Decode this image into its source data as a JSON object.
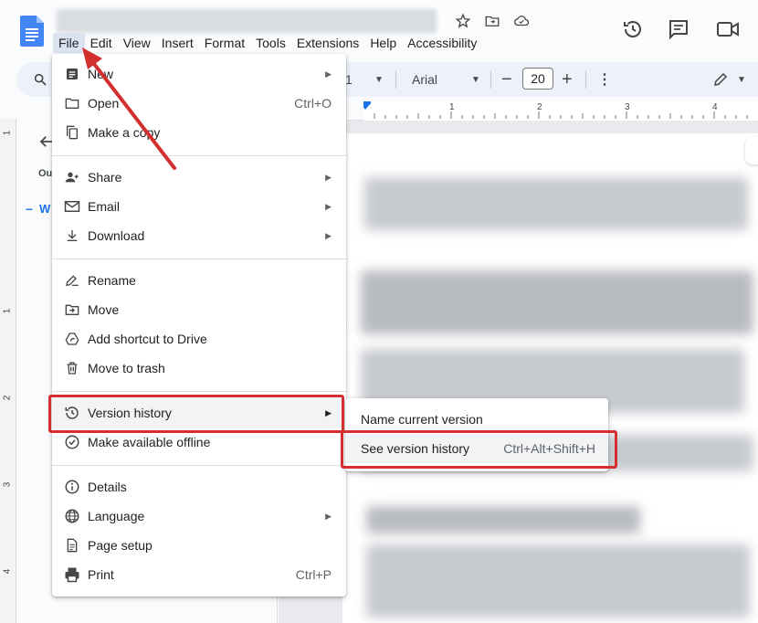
{
  "menubar": [
    "File",
    "Edit",
    "View",
    "Insert",
    "Format",
    "Tools",
    "Extensions",
    "Help",
    "Accessibility"
  ],
  "toolbar": {
    "font_name": "Arial",
    "font_size": "20",
    "zoom_partial": "1"
  },
  "ruler": {
    "numbers": [
      "1",
      "2",
      "3",
      "4"
    ]
  },
  "vruler": {
    "numbers": [
      "1",
      "1",
      "2",
      "3",
      "4"
    ]
  },
  "outline": {
    "abbrev": "Ou",
    "item_prefix": "W"
  },
  "file_menu": {
    "items": [
      {
        "label": "New",
        "shortcut": "",
        "arrow": true,
        "icon": "new-doc-icon"
      },
      {
        "label": "Open",
        "shortcut": "Ctrl+O",
        "arrow": false,
        "icon": "folder-icon"
      },
      {
        "label": "Make a copy",
        "shortcut": "",
        "arrow": false,
        "icon": "copy-icon"
      },
      {
        "label": "Share",
        "shortcut": "",
        "arrow": true,
        "icon": "person-add-icon"
      },
      {
        "label": "Email",
        "shortcut": "",
        "arrow": true,
        "icon": "mail-icon"
      },
      {
        "label": "Download",
        "shortcut": "",
        "arrow": true,
        "icon": "download-icon"
      },
      {
        "label": "Rename",
        "shortcut": "",
        "arrow": false,
        "icon": "rename-icon"
      },
      {
        "label": "Move",
        "shortcut": "",
        "arrow": false,
        "icon": "move-folder-icon"
      },
      {
        "label": "Add shortcut to Drive",
        "shortcut": "",
        "arrow": false,
        "icon": "drive-shortcut-icon"
      },
      {
        "label": "Move to trash",
        "shortcut": "",
        "arrow": false,
        "icon": "trash-icon"
      },
      {
        "label": "Version history",
        "shortcut": "",
        "arrow": true,
        "icon": "history-icon"
      },
      {
        "label": "Make available offline",
        "shortcut": "",
        "arrow": false,
        "icon": "offline-check-icon"
      },
      {
        "label": "Details",
        "shortcut": "",
        "arrow": false,
        "icon": "info-icon"
      },
      {
        "label": "Language",
        "shortcut": "",
        "arrow": true,
        "icon": "globe-icon"
      },
      {
        "label": "Page setup",
        "shortcut": "",
        "arrow": false,
        "icon": "page-icon"
      },
      {
        "label": "Print",
        "shortcut": "Ctrl+P",
        "arrow": false,
        "icon": "print-icon"
      }
    ]
  },
  "version_submenu": {
    "items": [
      {
        "label": "Name current version",
        "shortcut": ""
      },
      {
        "label": "See version history",
        "shortcut": "Ctrl+Alt+Shift+H"
      }
    ]
  },
  "colors": {
    "annotation_red": "#d32f2f",
    "docs_blue": "#4285f4"
  }
}
